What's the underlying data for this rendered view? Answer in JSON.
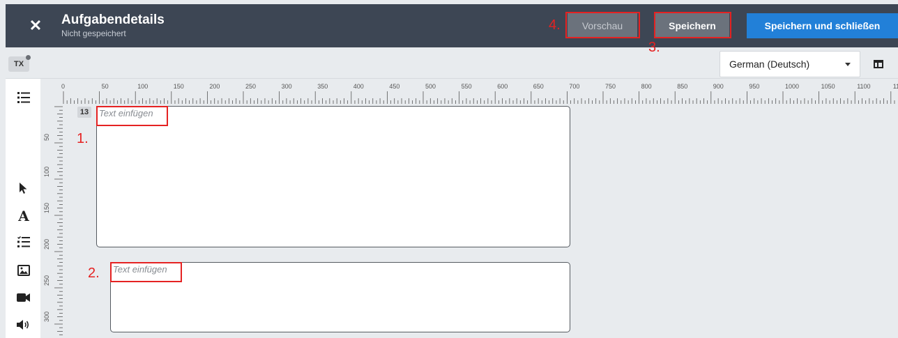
{
  "header": {
    "title": "Aufgabendetails",
    "subtitle": "Nicht gespeichert",
    "close_icon": "close-icon",
    "buttons": {
      "preview": "Vorschau",
      "save": "Speichern",
      "save_close": "Speichern und schließen"
    }
  },
  "annotations": [
    "1.",
    "2.",
    "3.",
    "4."
  ],
  "toolbar": {
    "tx_badge": "TX",
    "language": "German (Deutsch)",
    "layout_icon": "layout-toggle-icon"
  },
  "sidebar": {
    "icons": [
      "outline-list-icon",
      "pointer-icon",
      "text-icon",
      "checklist-icon",
      "image-icon",
      "video-icon",
      "audio-icon"
    ],
    "text_tool_label": "A"
  },
  "ruler": {
    "horizontal_labels": [
      "0",
      "50",
      "100",
      "150",
      "200",
      "250",
      "300",
      "350",
      "400",
      "450",
      "500",
      "550",
      "600",
      "650",
      "700",
      "750",
      "800",
      "850",
      "900",
      "950",
      "1000",
      "1050",
      "1100",
      "1150"
    ],
    "vertical_labels": [
      "50",
      "100",
      "150",
      "200",
      "250",
      "300"
    ]
  },
  "canvas": {
    "page_badge": "13",
    "text_box_1_placeholder": "Text einfügen",
    "text_box_2_placeholder": "Text einfügen"
  },
  "colors": {
    "header_bg": "#3d4654",
    "accent": "#2280d8",
    "highlight": "#e52222"
  }
}
